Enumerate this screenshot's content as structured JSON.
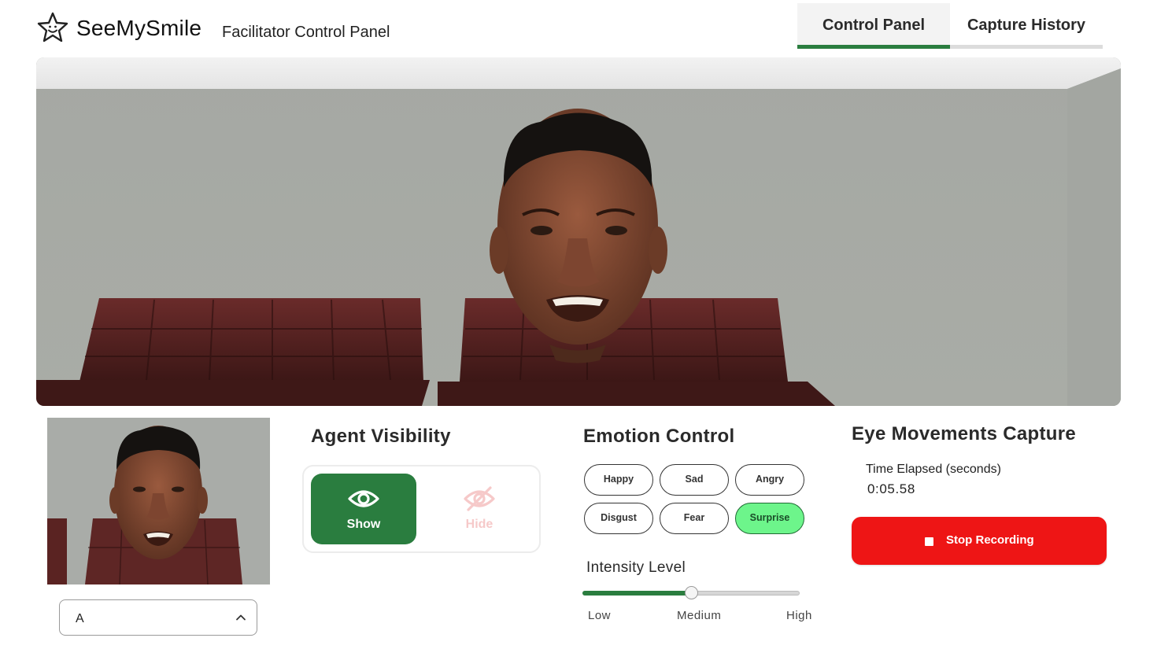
{
  "header": {
    "brand": "SeeMySmile",
    "subtitle": "Facilitator Control Panel",
    "logo_icon": "star-smile-icon"
  },
  "tabs": [
    {
      "label": "Control Panel",
      "active": true
    },
    {
      "label": "Capture History",
      "active": false
    }
  ],
  "preview": {
    "selected_agent": "A"
  },
  "visibility": {
    "title": "Agent Visibility",
    "show_label": "Show",
    "hide_label": "Hide",
    "selected": "Show"
  },
  "emotion": {
    "title": "Emotion Control",
    "options": [
      "Happy",
      "Sad",
      "Angry",
      "Disgust",
      "Fear",
      "Surprise"
    ],
    "selected": "Surprise",
    "intensity_title": "Intensity Level",
    "intensity_labels": [
      "Low",
      "Medium",
      "High"
    ],
    "intensity_value": 0.5
  },
  "capture": {
    "title": "Eye Movements Capture",
    "time_label": "Time Elapsed (seconds)",
    "time_value": "0:05.58",
    "stop_label": "Stop Recording"
  },
  "colors": {
    "accent_green": "#2a7d3f",
    "surprise_green": "#6df58b",
    "stop_red": "#ee1515"
  }
}
